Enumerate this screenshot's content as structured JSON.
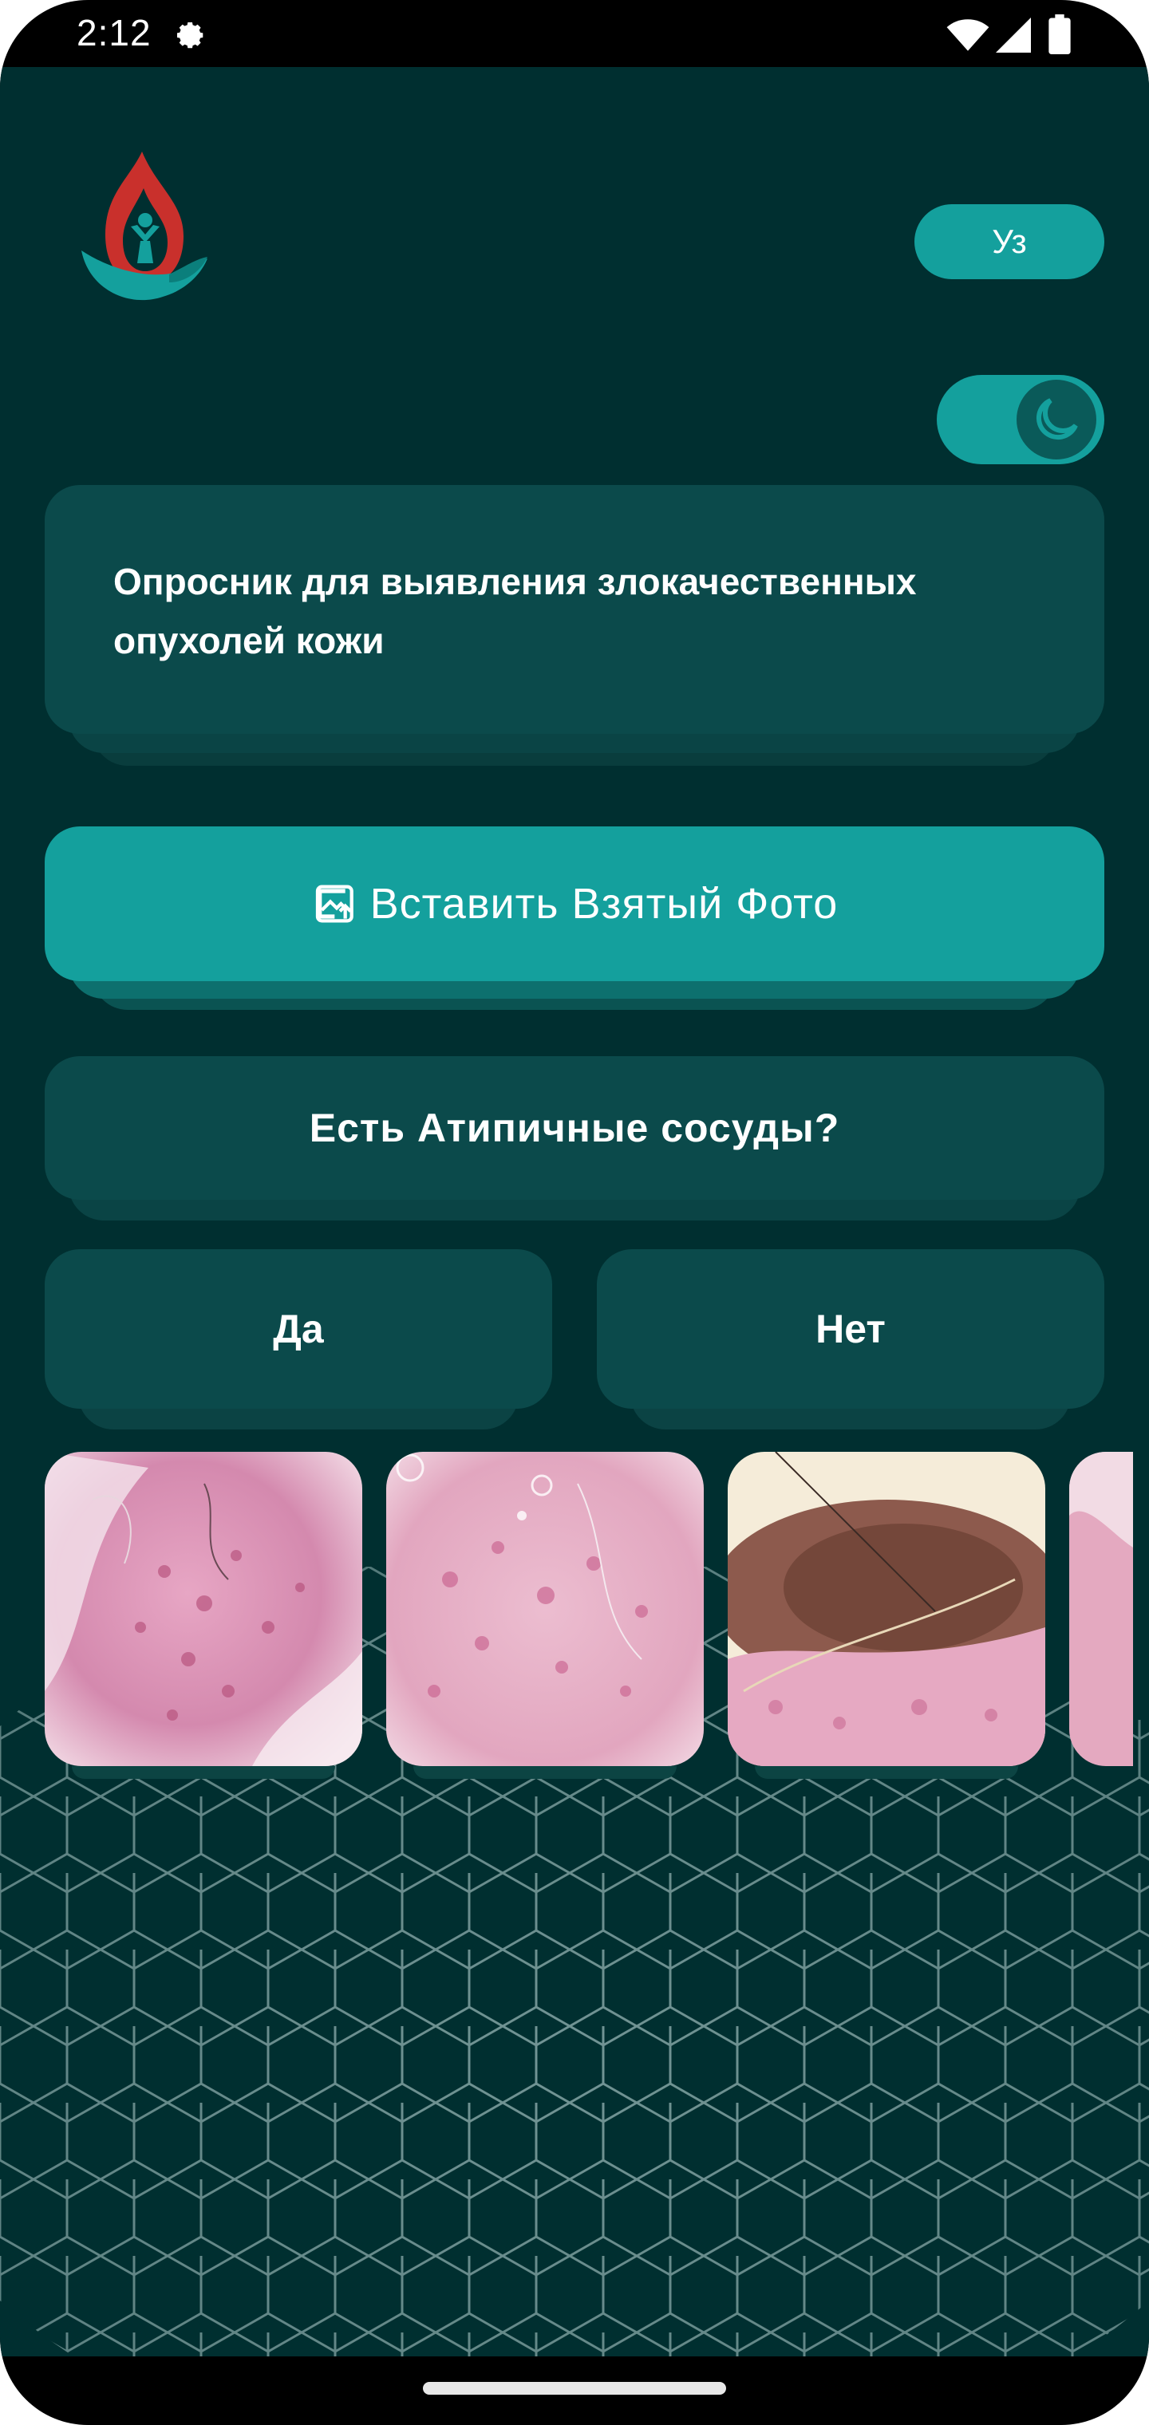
{
  "status_bar": {
    "time": "2:12",
    "icons": [
      "settings-gear-icon",
      "wifi-icon",
      "cell-signal-icon",
      "battery-icon"
    ]
  },
  "header": {
    "logo_icon": "flame-hand-logo-icon",
    "language_label": "Уз",
    "theme_toggle_icon": "moon-icon"
  },
  "title_card": {
    "text": "Опросник для выявления злокачественных опухолей кожи"
  },
  "upload_button": {
    "icon": "image-upload-icon",
    "label": "Вставить Взятый Фото"
  },
  "question": {
    "text": "Есть Атипичные сосуды?"
  },
  "answers": {
    "yes_label": "Да",
    "no_label": "Нет"
  },
  "examples": {
    "images": [
      "dermoscopy-example-1",
      "dermoscopy-example-2",
      "dermoscopy-example-3",
      "dermoscopy-example-4"
    ]
  },
  "colors": {
    "background": "#002f30",
    "card": "#0b4a4b",
    "accent": "#14a09d",
    "text": "#ffffff"
  }
}
